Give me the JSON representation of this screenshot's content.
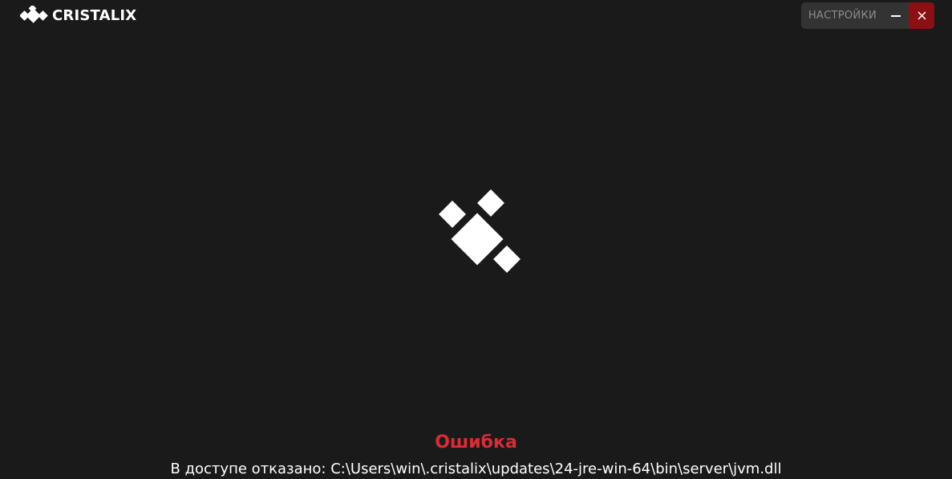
{
  "header": {
    "brand_name": "CRISTALIX",
    "settings_label": "НАСТРОЙКИ"
  },
  "icons": {
    "brand": "cristalix-diamonds-logo-icon",
    "minimize": "minimize-icon",
    "close": "close-icon",
    "loader": "cristalix-loading-spinner-icon"
  },
  "colors": {
    "background": "#1b1a1b",
    "accent_error": "#d92c34",
    "close_button": "#8b1014",
    "controls_background": "#343334",
    "settings_text": "#8d8c8d"
  },
  "error": {
    "title": "Ошибка",
    "message": "В доступе отказано: C:\\Users\\win\\.cristalix\\updates\\24-jre-win-64\\bin\\server\\jvm.dll"
  }
}
